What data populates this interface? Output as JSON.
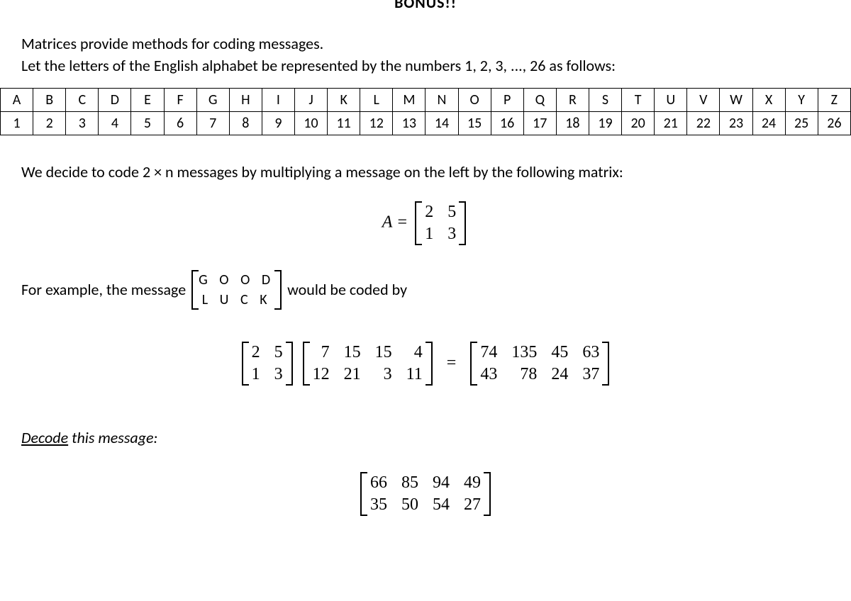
{
  "bonus": "BONUS!!",
  "intro_line1": "Matrices provide methods for coding messages.",
  "intro_line2": "Let the letters of the English alphabet be represented by the numbers 1, 2, 3, ..., 26 as follows:",
  "alphabet": {
    "letters": [
      "A",
      "B",
      "C",
      "D",
      "E",
      "F",
      "G",
      "H",
      "I",
      "J",
      "K",
      "L",
      "M",
      "N",
      "O",
      "P",
      "Q",
      "R",
      "S",
      "T",
      "U",
      "V",
      "W",
      "X",
      "Y",
      "Z"
    ],
    "numbers": [
      "1",
      "2",
      "3",
      "4",
      "5",
      "6",
      "7",
      "8",
      "9",
      "10",
      "11",
      "12",
      "13",
      "14",
      "15",
      "16",
      "17",
      "18",
      "19",
      "20",
      "21",
      "22",
      "23",
      "24",
      "25",
      "26"
    ]
  },
  "encode_text": "We decide to code 2 × n messages by multiplying a message on the left by the following matrix:",
  "matrix_A_label": "A =",
  "matrix_A": [
    [
      "2",
      "5"
    ],
    [
      "1",
      "3"
    ]
  ],
  "example_prefix": "For example, the message",
  "example_word_matrix": [
    [
      "G O O D"
    ],
    [
      "L U C K"
    ]
  ],
  "example_suffix": "would be coded by",
  "calc_A": [
    [
      "2",
      "5"
    ],
    [
      "1",
      "3"
    ]
  ],
  "calc_msg": [
    [
      "7",
      "15",
      "15",
      "4"
    ],
    [
      "12",
      "21",
      "3",
      "11"
    ]
  ],
  "calc_result": [
    [
      "74",
      "135",
      "45",
      "63"
    ],
    [
      "43",
      "78",
      "24",
      "37"
    ]
  ],
  "decode_label": "Decode",
  "decode_label_rest": " this message:",
  "decode_matrix": [
    [
      "66",
      "85",
      "94",
      "49"
    ],
    [
      "35",
      "50",
      "54",
      "27"
    ]
  ]
}
